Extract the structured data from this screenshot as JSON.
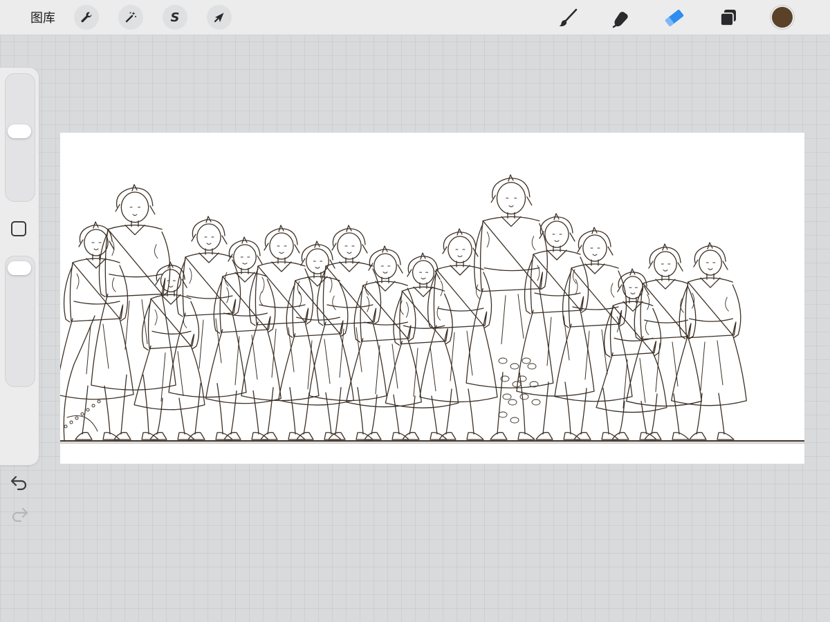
{
  "topbar": {
    "gallery_label": "图库",
    "left_tools": [
      {
        "name": "actions",
        "icon": "wrench-icon"
      },
      {
        "name": "adjustments",
        "icon": "magic-wand-icon"
      },
      {
        "name": "selection",
        "icon": "selection-s-icon",
        "glyph": "S"
      },
      {
        "name": "transform",
        "icon": "arrow-cursor-icon"
      }
    ],
    "right_tools": [
      {
        "name": "brush",
        "icon": "brush-icon",
        "active": false
      },
      {
        "name": "smudge",
        "icon": "smudge-finger-icon",
        "active": false
      },
      {
        "name": "eraser",
        "icon": "eraser-icon",
        "active": true
      },
      {
        "name": "layers",
        "icon": "layers-icon",
        "active": false
      }
    ],
    "current_color": "#5a4128",
    "active_tool_color": "#2f8cf0"
  },
  "sidebar": {
    "brush_size_level": 0.55,
    "brush_opacity_level": 0.95,
    "undo_icon": "undo-arrow-icon",
    "redo_icon": "redo-arrow-icon",
    "modify_icon": "square-modify-icon"
  },
  "canvas": {
    "content": "line-art-sketch",
    "line_color": "#3b2f25",
    "background_color": "#ffffff"
  }
}
